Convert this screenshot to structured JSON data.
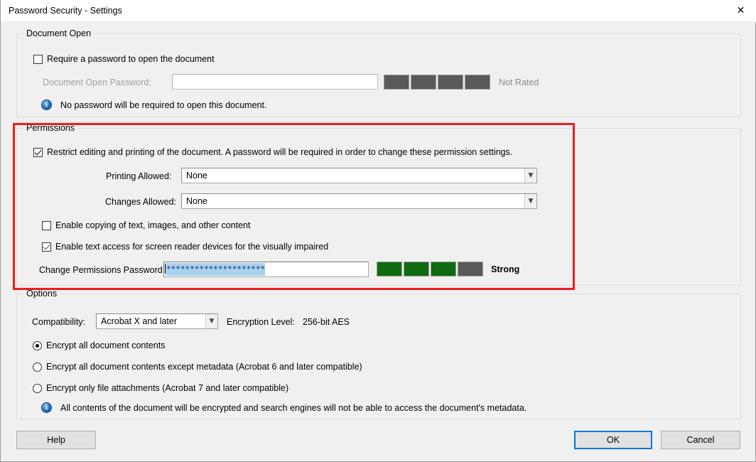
{
  "window": {
    "title": "Password Security - Settings",
    "close_icon": "✕"
  },
  "document_open": {
    "legend": "Document Open",
    "require_password_label": "Require a password to open the document",
    "require_password_checked": false,
    "password_label": "Document Open Password:",
    "password_value": "",
    "strength_label": "Not Rated",
    "strength_filled": 0,
    "strength_total": 4,
    "info_text": "No password will be required to open this document."
  },
  "permissions": {
    "legend": "Permissions",
    "restrict_label": "Restrict editing and printing of the document. A password will be required in order to change these permission settings.",
    "restrict_checked": true,
    "printing_label": "Printing Allowed:",
    "printing_value": "None",
    "changes_label": "Changes Allowed:",
    "changes_value": "None",
    "enable_copy_label": "Enable copying of text, images, and other content",
    "enable_copy_checked": false,
    "enable_screen_reader_label": "Enable text access for screen reader devices for the visually impaired",
    "enable_screen_reader_checked": true,
    "change_password_label": "Change Permissions Password:",
    "change_password_value": "*********************",
    "change_password_strength_label": "Strong",
    "strength_filled": 3,
    "strength_total": 4,
    "highlight_color": "#ee1b24",
    "strength_color": "#106b10"
  },
  "options": {
    "legend": "Options",
    "compatibility_label": "Compatibility:",
    "compatibility_value": "Acrobat X and later",
    "encryption_level_label": "Encryption  Level:",
    "encryption_level_value": "256-bit AES",
    "radio_all_contents": "Encrypt all document contents",
    "radio_except_metadata": "Encrypt all document contents except metadata (Acrobat 6 and later compatible)",
    "radio_only_attachments": "Encrypt only file attachments (Acrobat 7 and later compatible)",
    "selected_radio": 0,
    "info_text": "All contents of the document will be encrypted and search engines will not be able to access the document's metadata."
  },
  "buttons": {
    "help": "Help",
    "ok": "OK",
    "cancel": "Cancel"
  }
}
